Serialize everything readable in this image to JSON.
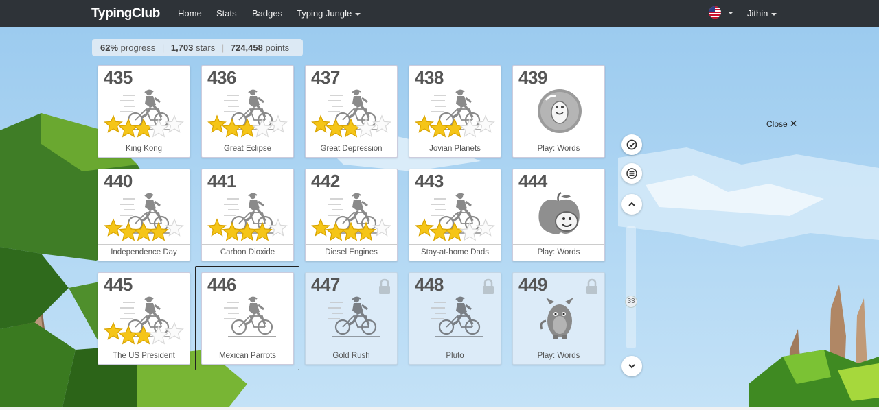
{
  "nav": {
    "brand": "TypingClub",
    "links": [
      "Home",
      "Stats",
      "Badges",
      "Typing Jungle"
    ],
    "user": "Jithin"
  },
  "stats": {
    "progress_value": "62%",
    "progress_label": "progress",
    "stars_value": "1,703",
    "stars_label": "stars",
    "points_value": "724,458",
    "points_label": "points"
  },
  "lessons": [
    {
      "num": "435",
      "title": "King Kong",
      "kind": "bike",
      "stars": 3,
      "locked": false
    },
    {
      "num": "436",
      "title": "Great Eclipse",
      "kind": "bike",
      "stars": 3,
      "locked": false
    },
    {
      "num": "437",
      "title": "Great Depression",
      "kind": "bike",
      "stars": 3,
      "locked": false
    },
    {
      "num": "438",
      "title": "Jovian Planets",
      "kind": "bike",
      "stars": 3,
      "locked": false
    },
    {
      "num": "439",
      "title": "Play: Words",
      "kind": "game-ball",
      "stars": 0,
      "locked": false
    },
    {
      "num": "440",
      "title": "Independence Day",
      "kind": "bike",
      "stars": 4,
      "locked": false
    },
    {
      "num": "441",
      "title": "Carbon Dioxide",
      "kind": "bike",
      "stars": 4,
      "locked": false
    },
    {
      "num": "442",
      "title": "Diesel Engines",
      "kind": "bike",
      "stars": 4,
      "locked": false
    },
    {
      "num": "443",
      "title": "Stay-at-home Dads",
      "kind": "bike",
      "stars": 3,
      "locked": false
    },
    {
      "num": "444",
      "title": "Play: Words",
      "kind": "game-apple",
      "stars": 0,
      "locked": false
    },
    {
      "num": "445",
      "title": "The US President",
      "kind": "bike",
      "stars": 3,
      "locked": false
    },
    {
      "num": "446",
      "title": "Mexican Parrots",
      "kind": "bike",
      "stars": 0,
      "locked": false
    },
    {
      "num": "447",
      "title": "Gold Rush",
      "kind": "bike",
      "stars": 0,
      "locked": true
    },
    {
      "num": "448",
      "title": "Pluto",
      "kind": "bike",
      "stars": 0,
      "locked": true
    },
    {
      "num": "449",
      "title": "Play: Words",
      "kind": "game-monster",
      "stars": 0,
      "locked": true
    }
  ],
  "selected_lesson": "446",
  "scroll": {
    "position": "33"
  },
  "close_label": "Close",
  "icons": {
    "flag": "us-flag-icon",
    "check": "check-circle-icon",
    "menu": "menu-lines-icon",
    "up": "chevron-up-icon",
    "down": "chevron-down-icon",
    "lock": "lock-icon",
    "close": "close-icon"
  },
  "colors": {
    "navbar": "#2e3338",
    "sky": "#a9d3f2",
    "star_gold": "#f5c518",
    "locked_card": "#dcebf8"
  }
}
